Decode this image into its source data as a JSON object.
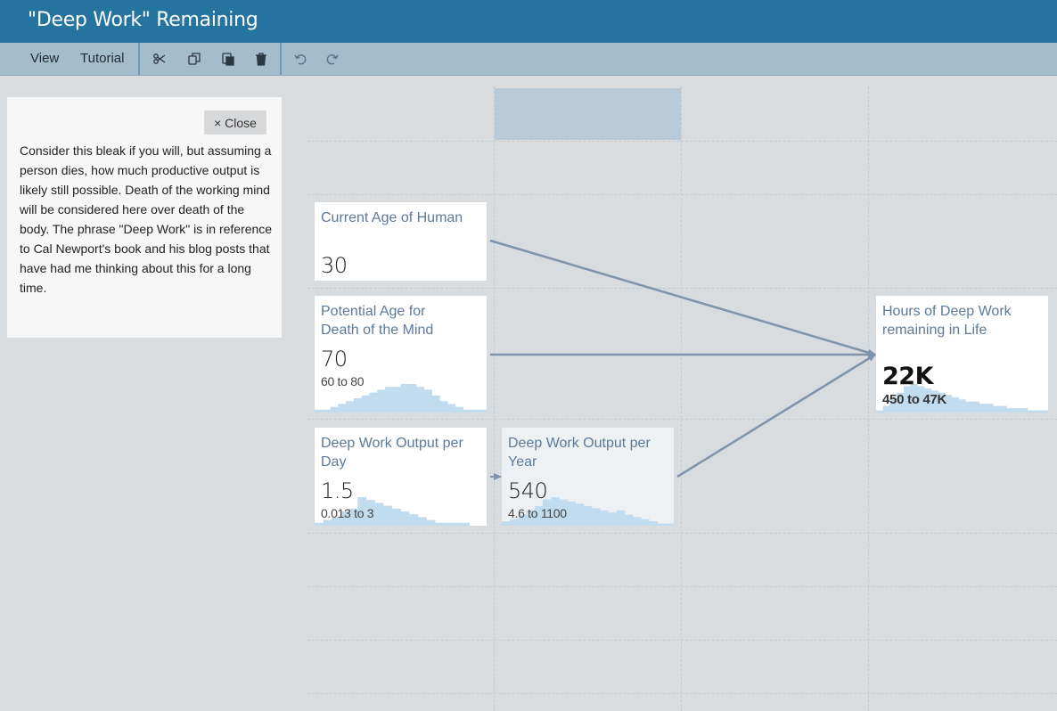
{
  "app": {
    "title": "\"Deep Work\" Remaining"
  },
  "toolbar": {
    "menu": [
      "View",
      "Tutorial"
    ],
    "tools": [
      "scissors-icon",
      "copy-icon",
      "paste-icon",
      "trash-icon",
      "undo-icon",
      "redo-icon"
    ]
  },
  "help": {
    "close_label": "× Close",
    "text": "Consider this bleak if you will, but assuming a person dies, how much productive output is likely still possible. Death of the working mind will be considered here over death of the body. The phrase \"Deep Work\" is in reference to Cal Newport's book and his blog posts that have had me thinking about this for a long time."
  },
  "nodes": {
    "current_age": {
      "title": "Current Age of Human",
      "value": "30"
    },
    "death_age": {
      "title": "Potential Age for Death of the Mind",
      "value": "70",
      "range": "60 to 80",
      "histogram": [
        1,
        1,
        2,
        3,
        4,
        5,
        6,
        7,
        8,
        9,
        9,
        10,
        10,
        9,
        8,
        6,
        4,
        3,
        2,
        1,
        1,
        1
      ]
    },
    "output_day": {
      "title": "Deep Work Output per Day",
      "value": "1.5",
      "range": "0.013 to 3",
      "histogram": [
        1,
        2,
        3,
        5,
        6,
        10,
        9,
        8,
        7,
        6,
        5,
        4,
        3,
        2,
        1,
        1,
        1,
        1,
        0,
        0
      ]
    },
    "output_year": {
      "title": "Deep Work Output per Year",
      "value": "540",
      "range": "4.6 to 1100",
      "histogram": [
        2,
        3,
        5,
        7,
        9,
        12,
        13,
        12,
        11,
        10,
        9,
        8,
        7,
        6,
        7,
        5,
        4,
        3,
        2,
        1,
        1
      ]
    },
    "result": {
      "title": "Hours of Deep Work remaining in Life",
      "value": "22K",
      "range": "450 to 47K",
      "histogram": [
        1,
        3,
        6,
        9,
        12,
        13,
        12,
        11,
        10,
        9,
        8,
        7,
        6,
        5,
        5,
        4,
        4,
        3,
        3,
        2,
        2,
        2,
        1,
        1,
        1
      ]
    }
  },
  "colors": {
    "title_bar": "#2574a0",
    "toolbar": "#a5bccc",
    "histogram": "#c2dcef",
    "arrow": "#7f93aa",
    "node_title": "#5c7a99"
  }
}
